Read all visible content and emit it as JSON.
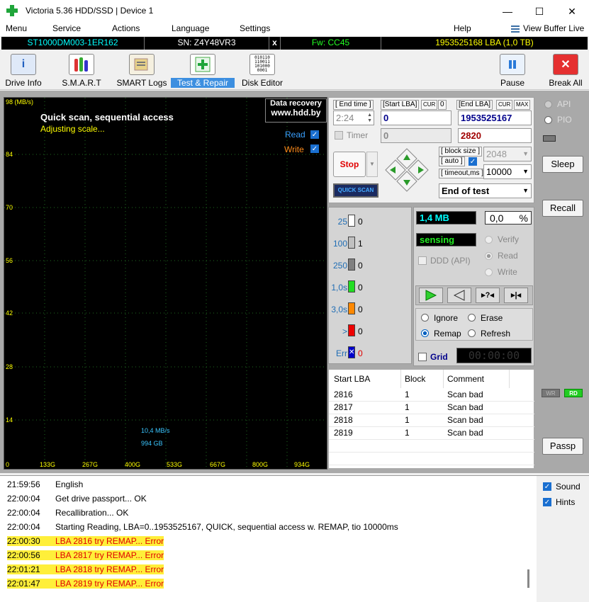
{
  "window": {
    "title": "Victoria 5.36 HDD/SSD | Device 1",
    "controls": [
      "—",
      "☐",
      "✕"
    ]
  },
  "menu": {
    "items": [
      "Menu",
      "Service",
      "Actions",
      "Language",
      "Settings",
      "Help"
    ],
    "view_buffer": "View Buffer Live"
  },
  "drive": {
    "model": "ST1000DM003-1ER162",
    "serial": "SN: Z4Y48VR3",
    "close": "x",
    "firmware": "Fw: CC45",
    "capacity": "1953525168 LBA (1,0 TB)"
  },
  "toolbar": {
    "drive_info": "Drive Info",
    "smart": "S.M.A.R.T",
    "smart_logs": "SMART Logs",
    "test_repair": "Test & Repair",
    "disk_editor": "Disk Editor",
    "pause": "Pause",
    "break_all": "Break All",
    "disk_editor_icon_text": "010110 110011 101000 0001"
  },
  "graph": {
    "y_unit": "98 (MB/s)",
    "y_ticks": [
      "84",
      "70",
      "56",
      "42",
      "28",
      "14"
    ],
    "x_ticks": [
      "0",
      "133G",
      "267G",
      "400G",
      "533G",
      "667G",
      "800G",
      "934G"
    ],
    "scan_title": "Quick scan, sequential access",
    "scan_status": "Adjusting scale...",
    "read_label": "Read",
    "write_label": "Write",
    "read_checked": true,
    "write_checked": true,
    "speed": "10,4 MB/s",
    "position": "994 GB",
    "banner_line1": "Data recovery",
    "banner_line2": "www.hdd.by"
  },
  "params": {
    "end_time_label": "[ End time ]",
    "end_time_value": "2:24",
    "start_lba_label": "[Start LBA]",
    "cur_label": "CUR",
    "start_cur_value": "0",
    "start_lba_value": "0",
    "end_lba_label": "[End LBA]",
    "max_label": "MAX",
    "end_lba_value": "1953525167",
    "timer_label": "Timer",
    "timer_value": "0",
    "current_lba": "2820",
    "block_size_label": "[ block size ]",
    "auto_label": "[ auto ]",
    "block_size_value": "2048",
    "timeout_label": "[ timeout,ms ]",
    "timeout_value": "10000",
    "stop_label": "Stop",
    "quick_scan_label": "QUICK SCAN",
    "end_action": "End of test"
  },
  "blocks": {
    "rows": [
      {
        "label": "25",
        "count": "0",
        "color": "#ffffff"
      },
      {
        "label": "100",
        "count": "1",
        "color": "#c0c0c0"
      },
      {
        "label": "250",
        "count": "0",
        "color": "#808080"
      },
      {
        "label": "1,0s",
        "count": "0",
        "color": "#22dd22"
      },
      {
        "label": "3,0s",
        "count": "0",
        "color": "#ff8800"
      },
      {
        "label": ">",
        "count": "0",
        "color": "#ee0000"
      },
      {
        "label": "Err",
        "count": "0",
        "color": "#0000cc"
      }
    ]
  },
  "status": {
    "transferred": "1,4 MB",
    "percent_value": "0,0",
    "percent_sign": "%",
    "mode": "sensing",
    "ddd_label": "DDD (API)",
    "verify": "Verify",
    "read": "Read",
    "write": "Write",
    "ignore": "Ignore",
    "erase": "Erase",
    "remap": "Remap",
    "refresh": "Refresh",
    "grid_label": "Grid",
    "elapsed": "00:00:00"
  },
  "bad_table": {
    "headers": [
      "Start LBA",
      "Block",
      "Comment"
    ],
    "rows": [
      [
        "2816",
        "1",
        "Scan bad"
      ],
      [
        "2817",
        "1",
        "Scan bad"
      ],
      [
        "2818",
        "1",
        "Scan bad"
      ],
      [
        "2819",
        "1",
        "Scan bad"
      ]
    ]
  },
  "right_panel": {
    "api": "API",
    "pio": "PIO",
    "sleep": "Sleep",
    "recall": "Recall",
    "wr": "WR",
    "rd": "RD",
    "passp": "Passp"
  },
  "log": {
    "entries": [
      {
        "time": "21:59:56",
        "msg": "English",
        "error": false
      },
      {
        "time": "22:00:04",
        "msg": "Get drive passport... OK",
        "error": false
      },
      {
        "time": "22:00:04",
        "msg": "Recallibration... OK",
        "error": false
      },
      {
        "time": "22:00:04",
        "msg": "Starting Reading, LBA=0..1953525167, QUICK, sequential access w. REMAP, tio 10000ms",
        "error": false
      },
      {
        "time": "22:00:30",
        "msg": "LBA 2816 try REMAP... Error",
        "error": true
      },
      {
        "time": "22:00:56",
        "msg": "LBA 2817 try REMAP... Error",
        "error": true
      },
      {
        "time": "22:01:21",
        "msg": "LBA 2818 try REMAP... Error",
        "error": true
      },
      {
        "time": "22:01:47",
        "msg": "LBA 2819 try REMAP... Error",
        "error": true
      }
    ],
    "sound": "Sound",
    "hints": "Hints"
  },
  "colors": {
    "accent": "#0078d7",
    "app_icon": "#1fa53a",
    "error_text": "#e00000",
    "highlight": "#ffef3a"
  }
}
